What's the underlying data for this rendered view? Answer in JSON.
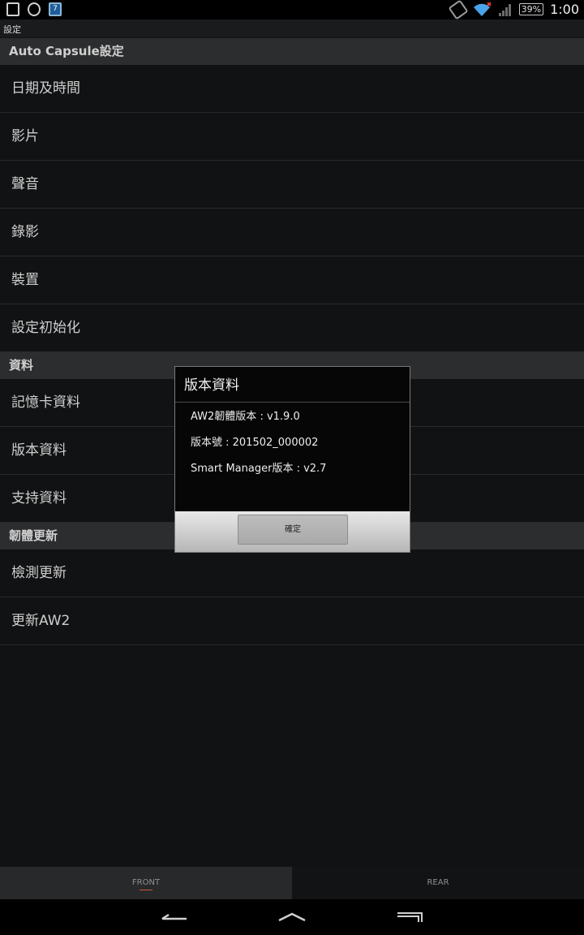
{
  "status": {
    "calendar_day": "7",
    "battery": "39%",
    "time": "1:00"
  },
  "app": {
    "title": "設定"
  },
  "sections": [
    {
      "header": "Auto Capsule設定",
      "items": [
        "日期及時間",
        "影片",
        "聲音",
        "錄影",
        "裝置",
        "設定初始化"
      ]
    },
    {
      "header": "資料",
      "items": [
        "記憶卡資料",
        "版本資料",
        "支持資料"
      ]
    },
    {
      "header": "韌體更新",
      "items": [
        "檢測更新",
        "更新AW2"
      ]
    }
  ],
  "dialog": {
    "title": "版本資料",
    "lines": [
      "AW2韌體版本 : v1.9.0",
      "版本號 : 201502_000002",
      "Smart Manager版本 : v2.7"
    ],
    "ok_label": "確定"
  },
  "tabs": [
    "FRONT",
    "REAR"
  ],
  "colors": {
    "background": "#111213",
    "section_header": "#2c2d2f",
    "tab_indicator": "#c75a3a"
  }
}
